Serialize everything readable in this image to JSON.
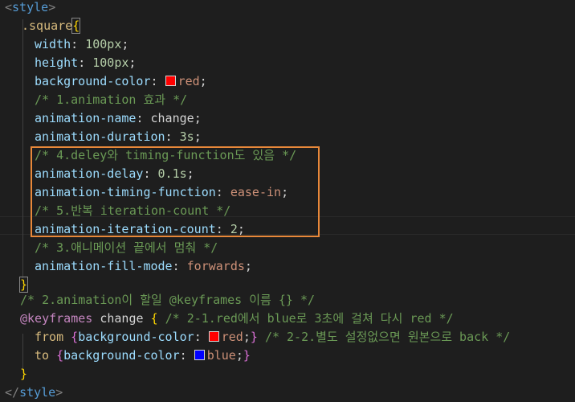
{
  "code": {
    "l1_open": "<",
    "l1_tag": "style",
    "l1_close": ">",
    "l2_sel": ".square",
    "l2_brace": "{",
    "l3_prop": "width",
    "l3_val": "100px",
    "l4_prop": "height",
    "l4_val": "100px",
    "l5_prop": "background-color",
    "l5_val": "red",
    "l6_comment": "/* 1.animation 효과 */",
    "l7_prop": "animation-name",
    "l7_val": "change",
    "l8_prop": "animation-duration",
    "l8_val": "3s",
    "l9_comment": "/* 4.deley와 timing-function도 있음 */",
    "l10_prop": "animation-delay",
    "l10_val": "0.1s",
    "l11_prop": "animation-timing-function",
    "l11_val": "ease-in",
    "l12_comment": "/* 5.반복 iteration-count */",
    "l13_prop": "animation-iteration-count",
    "l13_val": "2",
    "l14_comment": "/* 3.애니메이션 끝에서 멈춰 */",
    "l15_prop": "animation-fill-mode",
    "l15_val": "forwards",
    "l16_brace": "}",
    "l17_comment": "/* 2.animation이 할일 @keyframes 이름 {} */",
    "l18_at": "@keyframes",
    "l18_name": "change",
    "l18_brace": "{",
    "l18_comment": "/* 2-1.red에서 blue로 3초에 걸쳐 다시 red */",
    "l19_from": "from",
    "l19_prop": "background-color",
    "l19_val": "red",
    "l19_comment": "/* 2-2.별도 설정없으면 원본으로 back */",
    "l20_to": "to",
    "l20_prop": "background-color",
    "l20_val": "blue",
    "l21_brace": "}",
    "l22_open": "</",
    "l22_tag": "style",
    "l22_close": ">"
  },
  "colors": {
    "swatch_red": "#ff0000",
    "swatch_blue": "#0000ff",
    "highlight_box": "#e8883a",
    "background": "#1e1e1e"
  }
}
